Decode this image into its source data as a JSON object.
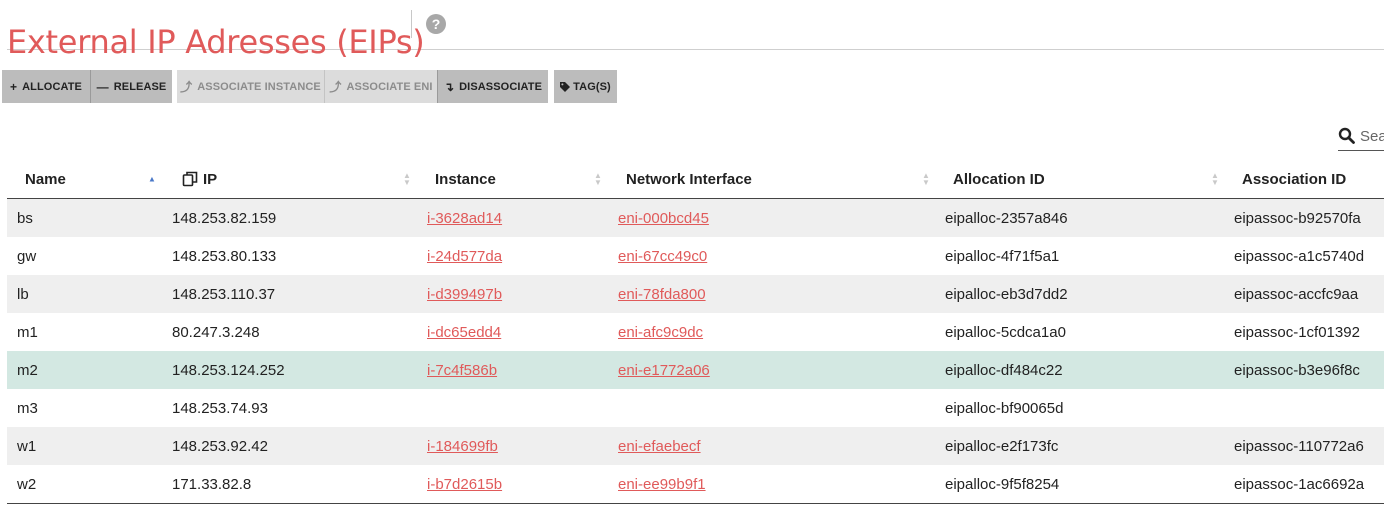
{
  "header": {
    "title": "External IP Adresses (EIPs)",
    "help_glyph": "?"
  },
  "toolbar": {
    "buttons": [
      {
        "icon": "plus-icon",
        "glyph": "+",
        "label": "ALLOCATE",
        "enabled": true
      },
      {
        "icon": "minus-icon",
        "glyph": "—",
        "label": "RELEASE",
        "enabled": true
      },
      {
        "icon": "associate-icon",
        "glyph": "⤴",
        "label": "ASSOCIATE INSTANCE",
        "enabled": false
      },
      {
        "icon": "associate-icon",
        "glyph": "⤴",
        "label": "ASSOCIATE ENI",
        "enabled": false
      },
      {
        "icon": "disassociate-icon",
        "glyph": "↴",
        "label": "DISASSOCIATE",
        "enabled": true
      },
      {
        "icon": "tag-icon",
        "glyph": "🏷",
        "label": "TAG(S)",
        "enabled": true
      }
    ]
  },
  "search": {
    "placeholder": "Search"
  },
  "table": {
    "columns": [
      "Name",
      "IP",
      "Instance",
      "Network Interface",
      "Allocation ID",
      "Association ID"
    ],
    "sorted_column": "Name",
    "sort_direction": "ascending",
    "rows": [
      {
        "name": "bs",
        "ip": "148.253.82.159",
        "instance": "i-3628ad14",
        "eni": "eni-000bcd45",
        "allocation_id": "eipalloc-2357a846",
        "association_id": "eipassoc-b92570fa",
        "selected": false
      },
      {
        "name": "gw",
        "ip": "148.253.80.133",
        "instance": "i-24d577da",
        "eni": "eni-67cc49c0",
        "allocation_id": "eipalloc-4f71f5a1",
        "association_id": "eipassoc-a1c5740d",
        "selected": false
      },
      {
        "name": "lb",
        "ip": "148.253.110.37",
        "instance": "i-d399497b",
        "eni": "eni-78fda800",
        "allocation_id": "eipalloc-eb3d7dd2",
        "association_id": "eipassoc-accfc9aa",
        "selected": false
      },
      {
        "name": "m1",
        "ip": "80.247.3.248",
        "instance": "i-dc65edd4",
        "eni": "eni-afc9c9dc",
        "allocation_id": "eipalloc-5cdca1a0",
        "association_id": "eipassoc-1cf01392",
        "selected": false
      },
      {
        "name": "m2",
        "ip": "148.253.124.252",
        "instance": "i-7c4f586b",
        "eni": "eni-e1772a06",
        "allocation_id": "eipalloc-df484c22",
        "association_id": "eipassoc-b3e96f8c",
        "selected": true
      },
      {
        "name": "m3",
        "ip": "148.253.74.93",
        "instance": "",
        "eni": "",
        "allocation_id": "eipalloc-bf90065d",
        "association_id": "",
        "selected": false
      },
      {
        "name": "w1",
        "ip": "148.253.92.42",
        "instance": "i-184699fb",
        "eni": "eni-efaebecf",
        "allocation_id": "eipalloc-e2f173fc",
        "association_id": "eipassoc-110772a6",
        "selected": false
      },
      {
        "name": "w2",
        "ip": "171.33.82.8",
        "instance": "i-b7d2615b",
        "eni": "eni-ee99b9f1",
        "allocation_id": "eipalloc-9f5f8254",
        "association_id": "eipassoc-1ac6692a",
        "selected": false
      }
    ]
  },
  "colors": {
    "accent": "#e05a5a",
    "selected_row": "#d3e8e2",
    "stripe": "#efefef",
    "sort_active": "#4a78c8"
  }
}
